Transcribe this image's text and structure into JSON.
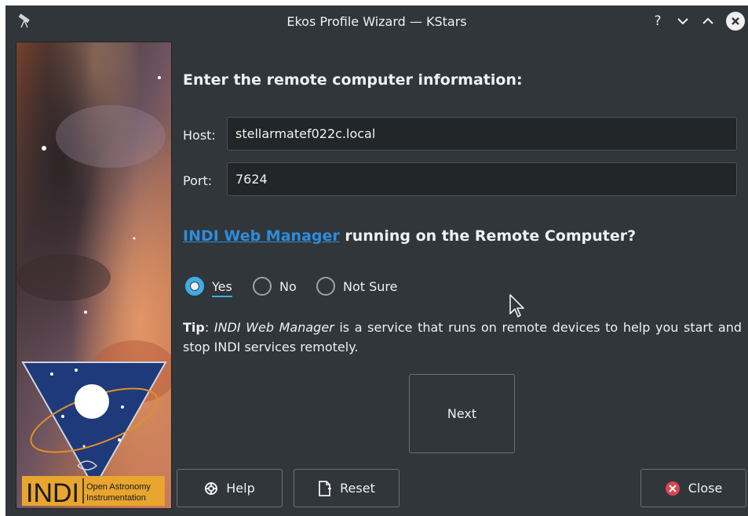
{
  "window": {
    "title": "Ekos Profile Wizard — KStars",
    "controls": {
      "help": "?",
      "minimize": "⌄",
      "maximize": "⌃",
      "close": "✕"
    }
  },
  "logo": {
    "brand": "INDI",
    "subtitle_line1": "Open Astronomy",
    "subtitle_line2": "Instrumentation"
  },
  "form": {
    "heading": "Enter the remote computer information:",
    "host_label": "Host:",
    "host_value": "stellarmatef022c.local",
    "port_label": "Port:",
    "port_value": "7624"
  },
  "question": {
    "link_text": "INDI Web Manager",
    "rest_text": " running on the Remote Computer?"
  },
  "options": {
    "yes": "Yes",
    "no": "No",
    "not_sure": "Not Sure",
    "selected": "yes"
  },
  "tip": {
    "label": "Tip",
    "separator": ": ",
    "emphasis": "INDI Web Manager",
    "text": " is a service that runs on remote devices to help you start and stop INDI services remotely."
  },
  "buttons": {
    "next": "Next",
    "help": "Help",
    "reset": "Reset",
    "close": "Close"
  },
  "colors": {
    "background": "#31363b",
    "accent": "#3daee9",
    "link": "#2e8cdb",
    "close_icon": "#da4453"
  }
}
